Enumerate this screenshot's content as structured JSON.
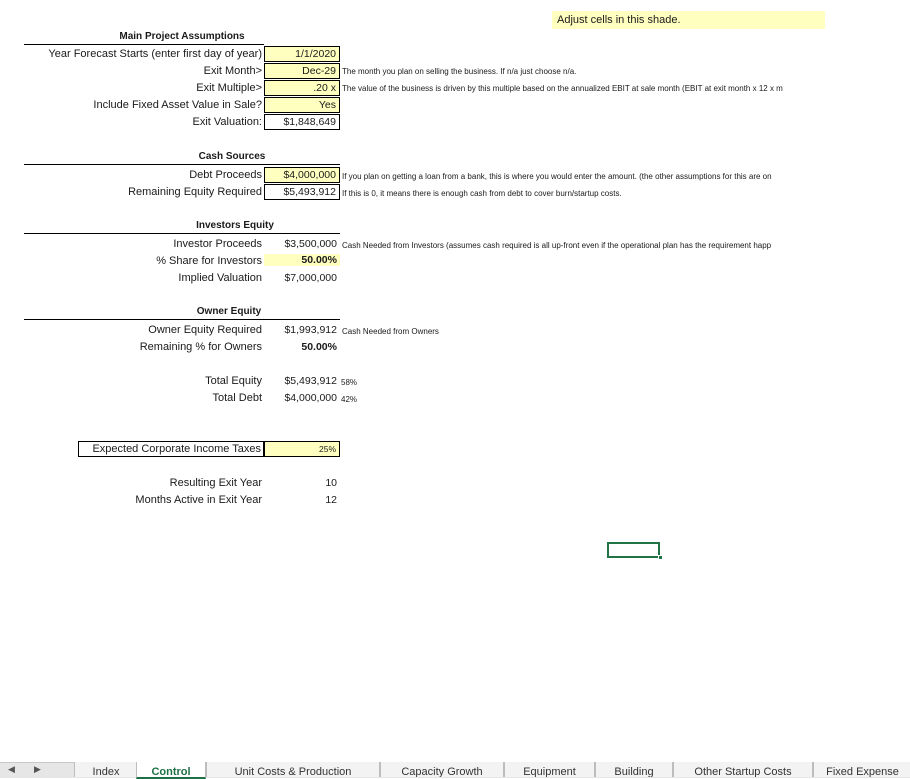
{
  "banner": "Adjust cells in this shade.",
  "main": {
    "title": "Main Project Assumptions",
    "rows": [
      {
        "label": "Year Forecast Starts (enter first day of year)",
        "value": "1/1/2020",
        "note": ""
      },
      {
        "label": "Exit Month>",
        "value": "Dec-29",
        "note": "The month you plan on selling the business. If n/a just choose n/a."
      },
      {
        "label": "Exit Multiple>",
        "value": ".20 x",
        "note": "The value of the business is driven by this multiple based on the annualized EBIT at sale month (EBIT at exit month x 12 x m"
      },
      {
        "label": "Include Fixed Asset Value in Sale?",
        "value": "Yes",
        "note": ""
      },
      {
        "label": "Exit Valuation:",
        "value": "$1,848,649",
        "note": ""
      }
    ]
  },
  "cash": {
    "title": "Cash Sources",
    "rows": [
      {
        "label": "Debt Proceeds",
        "value": "$4,000,000",
        "note": "If you plan on getting a loan from a bank, this is where you would enter the amount. (the other assumptions for this are on"
      },
      {
        "label": "Remaining Equity Required",
        "value": "$5,493,912",
        "note": "If this is 0, it means there is enough cash from debt to cover burn/startup costs."
      }
    ]
  },
  "investors": {
    "title": "Investors Equity",
    "rows": [
      {
        "label": "Investor Proceeds",
        "value": "$3,500,000",
        "note": "Cash Needed from Investors (assumes cash required is all up-front even if the operational plan has the requirement happ"
      },
      {
        "label": "% Share for Investors",
        "value": "50.00%",
        "note": ""
      },
      {
        "label": "Implied Valuation",
        "value": "$7,000,000",
        "note": ""
      }
    ]
  },
  "owner": {
    "title": "Owner Equity",
    "rows": [
      {
        "label": "Owner Equity Required",
        "value": "$1,993,912",
        "note": "Cash Needed from Owners"
      },
      {
        "label": "Remaining % for Owners",
        "value": "50.00%",
        "note": ""
      }
    ]
  },
  "totals": {
    "rows": [
      {
        "label": "Total Equity",
        "value": "$5,493,912",
        "pct": "58%"
      },
      {
        "label": "Total Debt",
        "value": "$4,000,000",
        "pct": "42%"
      }
    ]
  },
  "taxes": {
    "label": "Expected Corporate Income Taxes",
    "value": "25%"
  },
  "exit": {
    "rows": [
      {
        "label": "Resulting Exit Year",
        "value": "10"
      },
      {
        "label": "Months Active in Exit Year",
        "value": "12"
      }
    ]
  },
  "tabs": [
    "Index",
    "Control",
    "Unit Costs & Production",
    "Capacity Growth",
    "Equipment",
    "Building",
    "Other Startup Costs",
    "Fixed Expense"
  ],
  "active_tab": "Control",
  "colors": {
    "input_fill": "#ffffc0",
    "active_tab": "#1e7145",
    "selection": "#217346"
  }
}
